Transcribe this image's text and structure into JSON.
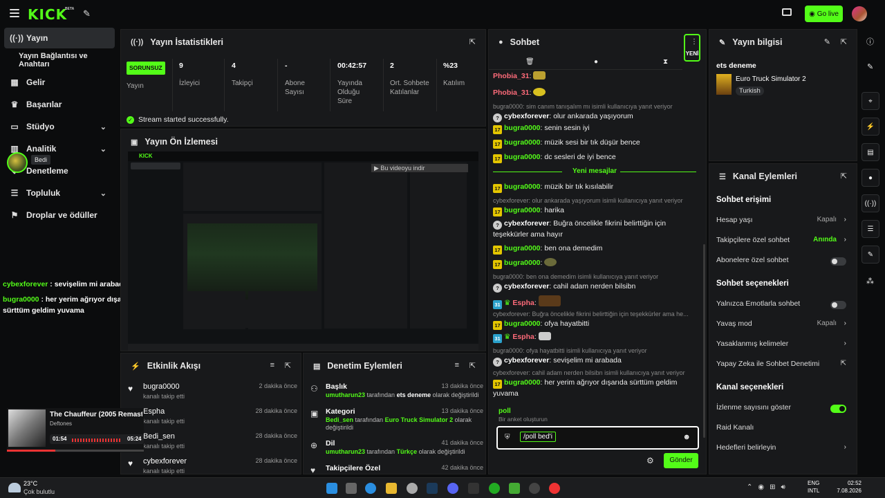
{
  "topbar": {
    "logo": "KICK",
    "beta": "BETA",
    "golive": "Go live"
  },
  "sidebar": {
    "items": [
      {
        "label": "Yayın",
        "icon": "stream-icon"
      },
      {
        "label": "Yayın Bağlantısı ve Anahtarı",
        "icon": ""
      },
      {
        "label": "Gelir",
        "icon": "dollar-icon"
      },
      {
        "label": "Başarılar",
        "icon": "trophy-icon"
      },
      {
        "label": "Stüdyo",
        "icon": "studio-icon"
      },
      {
        "label": "Analitik",
        "icon": "chart-icon"
      },
      {
        "label": "Denetleme",
        "icon": "shield-icon"
      },
      {
        "label": "Topluluk",
        "icon": "people-icon"
      },
      {
        "label": "Droplar ve ödüller",
        "icon": "gift-icon"
      }
    ],
    "tooltip": "Bedi"
  },
  "overlay_chat": [
    {
      "user": "cybexforever",
      "text": " : sevişelim mi arabada"
    },
    {
      "user": "bugra0000",
      "text": " : her yerim ağrıyor dışarıda sürttüm geldim yuvama"
    }
  ],
  "stats": {
    "title": "Yayın İstatistikleri",
    "items": [
      {
        "value": "SORUNSUZ",
        "label": "Yayın"
      },
      {
        "value": "9",
        "label": "İzleyici"
      },
      {
        "value": "4",
        "label": "Takipçi"
      },
      {
        "value": "-",
        "label": "Abone Sayısı"
      },
      {
        "value": "00:42:57",
        "label": "Yayında Olduğu Süre"
      },
      {
        "value": "2",
        "label": "Ort. Sohbete Katılanlar"
      },
      {
        "value": "%23",
        "label": "Katılım"
      }
    ],
    "status": "Stream started successfully."
  },
  "preview": {
    "title": "Yayın Ön İzlemesi",
    "overlay": "Bu videoyu indir"
  },
  "activity": {
    "title": "Etkinlik Akışı",
    "rows": [
      {
        "name": "bugra0000",
        "action": "kanalı takip etti",
        "time": "2 dakika önce"
      },
      {
        "name": "Espha",
        "action": "kanalı takip etti",
        "time": "28 dakika önce"
      },
      {
        "name": "Bedi_sen",
        "action": "kanalı takip etti",
        "time": "28 dakika önce"
      },
      {
        "name": "cybexforever",
        "action": "kanalı takip etti",
        "time": "28 dakika önce"
      }
    ]
  },
  "moderation": {
    "title": "Denetim Eylemleri",
    "rows": [
      {
        "title": "Başlık",
        "user": "umutharun23",
        "mid": " tarafından ",
        "target": "ets deneme",
        "end": " olarak değiştirildi",
        "time": "13 dakika önce"
      },
      {
        "title": "Kategori",
        "user": "Bedi_sen",
        "mid": " tarafından ",
        "target": "Euro Truck Simulator 2",
        "end": " olarak değiştirildi",
        "time": "13 dakika önce"
      },
      {
        "title": "Dil",
        "user": "umutharun23",
        "mid": " tarafından ",
        "target": "Türkçe",
        "end": " olarak değiştirildi",
        "time": "41 dakika önce"
      },
      {
        "title": "Takipçilere Özel",
        "user": "",
        "mid": "",
        "target": "",
        "end": "",
        "time": "42 dakika önce"
      }
    ]
  },
  "chat": {
    "title": "Sohbet",
    "new_badge": "YENİ",
    "new_messages": "Yeni mesajlar",
    "poll_cmd": "poll",
    "poll_desc": "Bir anket oluşturun",
    "input_value": "/poll bed'i",
    "send": "Gönder",
    "messages": [
      {
        "reply": "",
        "user": "Phobia_31",
        "text": ""
      },
      {
        "reply": "",
        "user": "Phobia_31",
        "text": ""
      },
      {
        "reply": "bugra0000: sim canım tanışalım mı isimli kullanıcıya yanıt veriyor",
        "user": "cybexforever",
        "text": " olur ankarada yaşıyorum"
      },
      {
        "reply": "",
        "user": "bugra0000",
        "text": " senin sesin iyi"
      },
      {
        "reply": "",
        "user": "bugra0000",
        "text": " müzik sesi bir tık düşür bence"
      },
      {
        "reply": "",
        "user": "bugra0000",
        "text": " dc sesleri de iyi bence"
      },
      {
        "reply": "",
        "user": "bugra0000",
        "text": " müzik bir tık kısılabilir"
      },
      {
        "reply": "cybexforever: olur ankarada yaşıyorum isimli kullanıcıya yanıt veriyor",
        "user": "bugra0000",
        "text": " harika"
      },
      {
        "reply": "",
        "user": "cybexforever",
        "text": " Buğra öncelikle fikrini belirttiğin için teşekkürler ama hayır"
      },
      {
        "reply": "",
        "user": "bugra0000",
        "text": " ben ona demedim"
      },
      {
        "reply": "",
        "user": "bugra0000",
        "text": ""
      },
      {
        "reply": "bugra0000: ben ona demedim isimli kullanıcıya yanıt veriyor",
        "user": "cybexforever",
        "text": " cahil adam nerden bilsibn"
      },
      {
        "reply": "",
        "user": "Espha",
        "text": ""
      },
      {
        "reply": "cybexforever: Buğra öncelikle fikrini belirttiğin için teşekkürler ama he...",
        "user": "bugra0000",
        "text": " ofya hayatbitti"
      },
      {
        "reply": "",
        "user": "Espha",
        "text": ""
      },
      {
        "reply": "bugra0000: ofya hayatbitti isimli kullanıcıya yanıt veriyor",
        "user": "cybexforever",
        "text": " sevişelim mi arabada"
      },
      {
        "reply": "cybexforever: cahil adam nerden bilsibn isimli kullanıcıya yanıt veriyor",
        "user": "bugra0000",
        "text": " her yerim ağrıyor dışarıda sürttüm geldim yuvama"
      }
    ]
  },
  "info": {
    "title": "Yayın bilgisi",
    "stream_title": "ets deneme",
    "game": "Euro Truck Simulator 2",
    "tag": "Turkish"
  },
  "channel": {
    "title": "Kanal Eylemleri",
    "sec1": "Sohbet erişimi",
    "s1": [
      {
        "label": "Hesap yaşı",
        "value": "Kapalı"
      },
      {
        "label": "Takipçilere özel sohbet",
        "value": "Anında"
      },
      {
        "label": "Abonelere özel sohbet",
        "value": ""
      }
    ],
    "sec2": "Sohbet seçenekleri",
    "s2": [
      {
        "label": "Yalnızca Emotlarla sohbet",
        "value": ""
      },
      {
        "label": "Yavaş mod",
        "value": "Kapalı"
      },
      {
        "label": "Yasaklanmış kelimeler",
        "value": ""
      },
      {
        "label": "Yapay Zeka ile Sohbet Denetimi",
        "value": ""
      }
    ],
    "sec3": "Kanal seçenekleri",
    "s3": [
      {
        "label": "İzlenme sayısını göster",
        "value": ""
      },
      {
        "label": "Raid Kanalı",
        "value": ""
      },
      {
        "label": "Hedefleri belirleyin",
        "value": ""
      }
    ]
  },
  "music": {
    "title": "The Chauffeur (2005 Remaster)",
    "artist": "Deftones",
    "elapsed": "01:54",
    "total": "05:24"
  },
  "taskbar": {
    "temp": "23°C",
    "weather": "Çok bulutlu",
    "lang1": "ENG",
    "lang2": "INTL",
    "time": "02:52",
    "date": "7.08.2026"
  },
  "colors": {
    "accent": "#53fc18",
    "panel": "#18191b",
    "bg": "#0b0c0d"
  }
}
